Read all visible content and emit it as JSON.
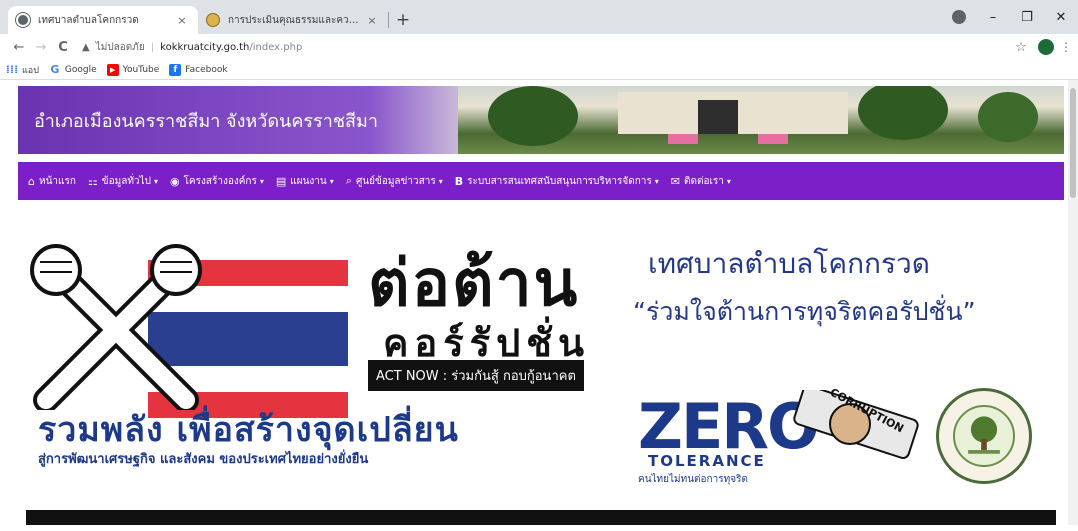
{
  "browser": {
    "tabs": [
      {
        "title": "เทศบาลตำบลโคกกรวด",
        "close": "×",
        "active": true,
        "favicon": "globe-icon"
      },
      {
        "title": "การประเมินคุณธรรมและความโปร่งใสการ",
        "close": "×",
        "active": false,
        "favicon": "emblem-icon"
      }
    ],
    "new_tab": "+",
    "window_controls": {
      "minimize": "–",
      "maximize": "❐",
      "close": "✕"
    },
    "nav": {
      "back": "←",
      "forward": "→",
      "reload": "C"
    },
    "address": {
      "warning": "▲",
      "insecure_label": "ไม่ปลอดภัย",
      "separator": "|",
      "host": "kokkruatcity.go.th",
      "path": "/index.php"
    },
    "star": "☆",
    "menu": "⋮",
    "bookmarks": [
      {
        "label": "แอป",
        "icon": "apps-icon",
        "color": "#4285f4"
      },
      {
        "label": "Google",
        "icon": "google-icon",
        "color": "#4285f4"
      },
      {
        "label": "YouTube",
        "icon": "youtube-icon",
        "color": "#ff0000"
      },
      {
        "label": "Facebook",
        "icon": "facebook-icon",
        "color": "#1877f2"
      }
    ]
  },
  "site": {
    "banner_title": "อำเภอเมืองนครราชสีมา จังหวัดนครราชสีมา",
    "nav": [
      {
        "label": "หน้าแรก",
        "icon": "home-icon",
        "glyph": "⌂",
        "dropdown": false
      },
      {
        "label": "ข้อมูลทั่วไป",
        "icon": "sitemap-icon",
        "glyph": "⚏",
        "dropdown": true
      },
      {
        "label": "โครงสร้างองค์กร",
        "icon": "user-icon",
        "glyph": "◉",
        "dropdown": true
      },
      {
        "label": "แผนงาน",
        "icon": "book-icon",
        "glyph": "▤",
        "dropdown": true
      },
      {
        "label": "ศูนย์ข้อมูลข่าวสาร",
        "icon": "search-icon",
        "glyph": "⌕",
        "dropdown": true
      },
      {
        "label": "ระบบสารสนเทศสนับสนุนการบริหารจัดการ",
        "icon": "bold-b-icon",
        "glyph": "B",
        "dropdown": true
      },
      {
        "label": "ติดต่อเรา",
        "icon": "mail-icon",
        "glyph": "✉",
        "dropdown": true
      }
    ],
    "caret": "▾",
    "hero": {
      "headline_1": "ต่อต้าน",
      "headline_2": "คอร์รัปชั่น",
      "act_now": "ACT NOW : ร่วมกันสู้ กอบกู้อนาคต",
      "slogan_1": "รวมพลัง เพื่อสร้างจุดเปลี่ยน",
      "slogan_2": "สู่การพัฒนาเศรษฐกิจ และสังคม ของประเทศไทยอย่างยั่งยืน",
      "municipality": "เทศบาลตำบลโคกกรวด",
      "motto": "“ร่วมใจต้านการทุจริตคอรัปชั่น”",
      "zero_word": "ZERO",
      "tolerance": "TOLERANCE",
      "zero_sub": "คนไทยไม่ทนต่อการทุจริต",
      "corruption_tag": "CORRUPTION"
    }
  }
}
